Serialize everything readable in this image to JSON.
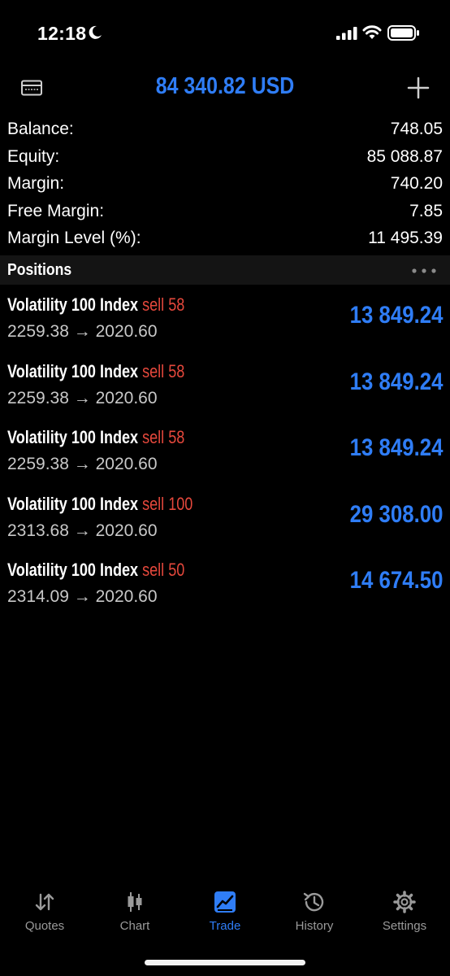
{
  "status_bar": {
    "time": "12:18"
  },
  "header": {
    "balance": "84 340.82 USD"
  },
  "summary": [
    {
      "label": "Balance:",
      "value": "748.05"
    },
    {
      "label": "Equity:",
      "value": "85 088.87"
    },
    {
      "label": "Margin:",
      "value": "740.20"
    },
    {
      "label": "Free Margin:",
      "value": "7.85"
    },
    {
      "label": "Margin Level (%):",
      "value": "11 495.39"
    }
  ],
  "positions": {
    "title": "Positions",
    "items": [
      {
        "symbol": "Volatility 100 Index",
        "side": "sell 58",
        "open": "2259.38",
        "arrow": "→",
        "current": "2020.60",
        "profit": "13 849.24"
      },
      {
        "symbol": "Volatility 100 Index",
        "side": "sell 58",
        "open": "2259.38",
        "arrow": "→",
        "current": "2020.60",
        "profit": "13 849.24"
      },
      {
        "symbol": "Volatility 100 Index",
        "side": "sell 58",
        "open": "2259.38",
        "arrow": "→",
        "current": "2020.60",
        "profit": "13 849.24"
      },
      {
        "symbol": "Volatility 100 Index",
        "side": "sell 100",
        "open": "2313.68",
        "arrow": "→",
        "current": "2020.60",
        "profit": "29 308.00"
      },
      {
        "symbol": "Volatility 100 Index",
        "side": "sell 50",
        "open": "2314.09",
        "arrow": "→",
        "current": "2020.60",
        "profit": "14 674.50"
      }
    ]
  },
  "tabs": [
    {
      "label": "Quotes",
      "icon": "quotes-icon"
    },
    {
      "label": "Chart",
      "icon": "chart-icon"
    },
    {
      "label": "Trade",
      "icon": "trade-icon"
    },
    {
      "label": "History",
      "icon": "history-icon"
    },
    {
      "label": "Settings",
      "icon": "settings-icon"
    }
  ],
  "colors": {
    "accent": "#2f7df6",
    "sell": "#e5483c",
    "background": "#000000"
  }
}
